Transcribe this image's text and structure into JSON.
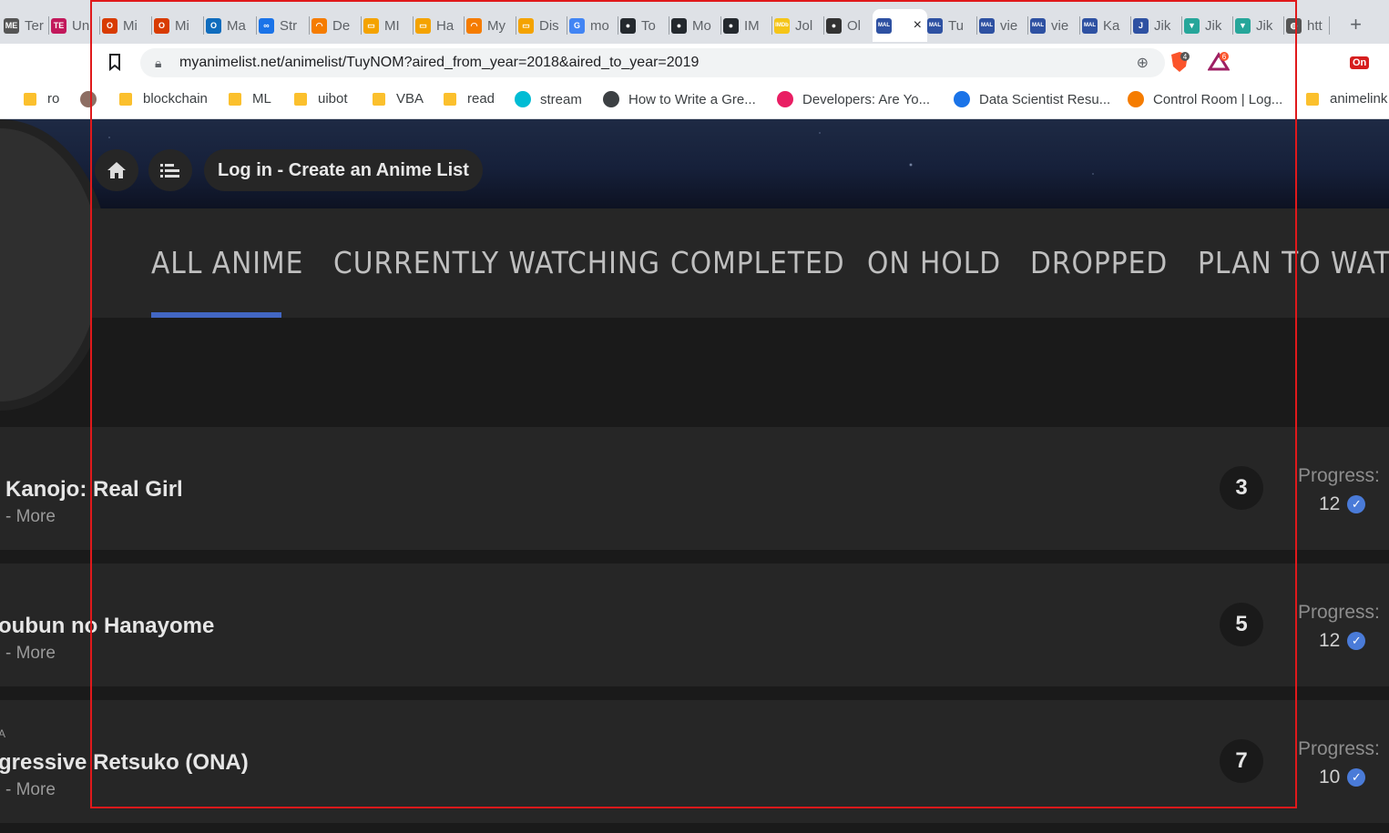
{
  "browser": {
    "tabs": [
      {
        "label": "Ter",
        "fav": "ME",
        "color": "#555"
      },
      {
        "label": "Un",
        "fav": "TE",
        "color": "#c2185b"
      },
      {
        "label": "Mi",
        "fav": "O",
        "color": "#d83b01"
      },
      {
        "label": "Mi",
        "fav": "O",
        "color": "#d83b01"
      },
      {
        "label": "Ma",
        "fav": "O",
        "color": "#0f6cbd"
      },
      {
        "label": "Str",
        "fav": "∞",
        "color": "#1a73e8"
      },
      {
        "label": "De",
        "fav": "◠",
        "color": "#f57c00"
      },
      {
        "label": "MI",
        "fav": "▭",
        "color": "#f4a300"
      },
      {
        "label": "Ha",
        "fav": "▭",
        "color": "#f4a300"
      },
      {
        "label": "My",
        "fav": "◠",
        "color": "#f57c00"
      },
      {
        "label": "Dis",
        "fav": "▭",
        "color": "#f4a300"
      },
      {
        "label": "mo",
        "fav": "G",
        "color": "#4285f4"
      },
      {
        "label": "To",
        "fav": "●",
        "color": "#24292e"
      },
      {
        "label": "Mo",
        "fav": "●",
        "color": "#24292e"
      },
      {
        "label": "IM",
        "fav": "●",
        "color": "#24292e"
      },
      {
        "label": "Jol",
        "fav": "IMDb",
        "color": "#f5c518"
      },
      {
        "label": "Ol",
        "fav": "●",
        "color": "#333"
      },
      {
        "label": "",
        "fav": "MAL",
        "color": "#2e51a2"
      },
      {
        "label": "Tu",
        "fav": "MAL",
        "color": "#2e51a2"
      },
      {
        "label": "vie",
        "fav": "MAL",
        "color": "#2e51a2"
      },
      {
        "label": "vie",
        "fav": "MAL",
        "color": "#2e51a2"
      },
      {
        "label": "Ka",
        "fav": "MAL",
        "color": "#2e51a2"
      },
      {
        "label": "Jik",
        "fav": "J",
        "color": "#2e51a2"
      },
      {
        "label": "Jik",
        "fav": "▼",
        "color": "#26a69a"
      },
      {
        "label": "Jik",
        "fav": "▼",
        "color": "#26a69a"
      },
      {
        "label": "htt",
        "fav": "◍",
        "color": "#555"
      }
    ],
    "active_tab_close": "×",
    "new_tab": "+",
    "url": "myanimelist.net/animelist/TuyNOM?aired_from_year=2018&aired_to_year=2019",
    "brave_badge": "4",
    "bat_badge": "6",
    "ext_label": "On",
    "bookmarks": [
      {
        "label": "ro",
        "kind": "folder"
      },
      {
        "label": "",
        "kind": "zi"
      },
      {
        "label": "blockchain",
        "kind": "folder"
      },
      {
        "label": "ML",
        "kind": "folder"
      },
      {
        "label": "uibot",
        "kind": "folder"
      },
      {
        "label": "VBA",
        "kind": "folder"
      },
      {
        "label": "read",
        "kind": "folder"
      },
      {
        "label": "stream",
        "kind": "play"
      },
      {
        "label": "How to Write a Gre...",
        "kind": "site"
      },
      {
        "label": "Developers: Are Yo...",
        "kind": "site2"
      },
      {
        "label": "Data Scientist Resu...",
        "kind": "site3"
      },
      {
        "label": "Control Room | Log...",
        "kind": "site4"
      },
      {
        "label": "animelink",
        "kind": "folder"
      }
    ]
  },
  "header": {
    "home_icon": "⌂",
    "list_icon": "☰",
    "login_label": "Log in - Create an Anime List"
  },
  "nav": {
    "tabs": [
      {
        "label": "All Anime",
        "active": true
      },
      {
        "label": "Currently Watching",
        "active": false
      },
      {
        "label": "Completed",
        "active": false
      },
      {
        "label": "On Hold",
        "active": false
      },
      {
        "label": "Dropped",
        "active": false
      },
      {
        "label": "Plan to Watch",
        "active": false
      }
    ]
  },
  "entries": [
    {
      "type": "",
      "title": "Kanojo: Real Girl",
      "title_prefix": "",
      "more": "- More",
      "score": "3",
      "progress_label": "Progress:",
      "progress": "12"
    },
    {
      "type": "",
      "title": "oubun no Hanayome",
      "more": "- More",
      "score": "5",
      "progress_label": "Progress:",
      "progress": "12"
    },
    {
      "type": "A",
      "title": "gressive Retsuko (ONA)",
      "more": "- More",
      "score": "7",
      "progress_label": "Progress:",
      "progress": "10"
    }
  ]
}
